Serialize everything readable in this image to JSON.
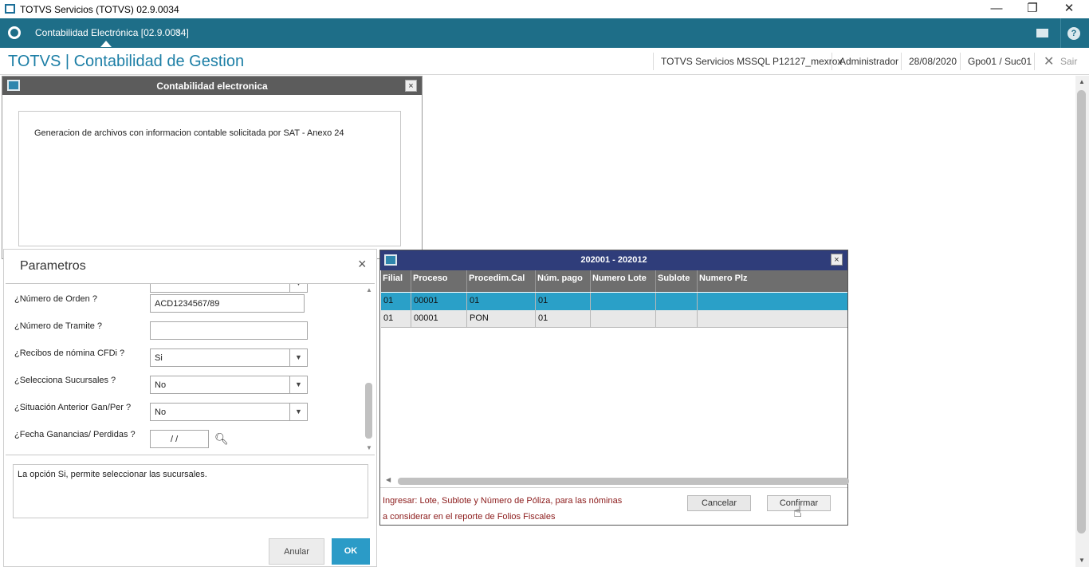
{
  "window": {
    "title": "TOTVS Servicios (TOTVS) 02.9.0034",
    "minimize": "—",
    "restore": "❐",
    "close": "✕"
  },
  "tabbar": {
    "tab_label": "Contabilidad Electrónica [02.9.0034]",
    "tab_close": "×",
    "help": "?"
  },
  "header": {
    "app_title": "TOTVS | Contabilidad de Gestion",
    "server": "TOTVS Servicios MSSQL P12127_mexrox",
    "user": "Administrador",
    "date": "28/08/2020",
    "branch": "Gpo01 / Suc01",
    "exit_icon": "✕",
    "exit_label": "Sair"
  },
  "ce_dialog": {
    "title": "Contabilidad electronica",
    "close": "×",
    "description": "Generacion de archivos con informacion contable solicitada por SAT - Anexo 24"
  },
  "parametros": {
    "title": "Parametros",
    "close": "×",
    "fields": [
      {
        "label": "¿Número de Orden ?",
        "value": "ACD1234567/89"
      },
      {
        "label": "¿Número de Tramite ?",
        "value": ""
      },
      {
        "label": "¿Recibos de nómina CFDi ?",
        "value": "Si"
      },
      {
        "label": "¿Selecciona Sucursales ?",
        "value": "No"
      },
      {
        "label": "¿Situación Anterior Gan/Per ?",
        "value": "No"
      },
      {
        "label": "¿Fecha Ganancias/ Perdidas ?",
        "value": " /  /"
      }
    ],
    "help_text": "La opción Si, permite seleccionar las sucursales.",
    "anular_label": "Anular",
    "ok_label": "OK"
  },
  "grid_dialog": {
    "title": "202001 - 202012",
    "close": "×",
    "columns": [
      "Filial",
      "Proceso",
      "Procedim.Cal",
      "Núm. pago",
      "Numero Lote",
      "Sublote",
      "Numero Plz"
    ],
    "rows": [
      [
        "01",
        "00001",
        "01",
        "01",
        "",
        "",
        ""
      ],
      [
        "01",
        "00001",
        "PON",
        "01",
        "",
        "",
        ""
      ]
    ],
    "note_line1": "Ingresar: Lote, Sublote y Número de Póliza, para las nóminas",
    "note_line2": "a considerar en el reporte de Folios Fiscales",
    "cancel_label": "Cancelar",
    "confirm_label": "Confirmar"
  },
  "colors": {
    "tabbar": "#1e6e88",
    "accent": "#2b9bc7",
    "grid_header": "#2f3d7a",
    "selected_row": "#2aa0c8",
    "note_text": "#8b1a1a"
  }
}
